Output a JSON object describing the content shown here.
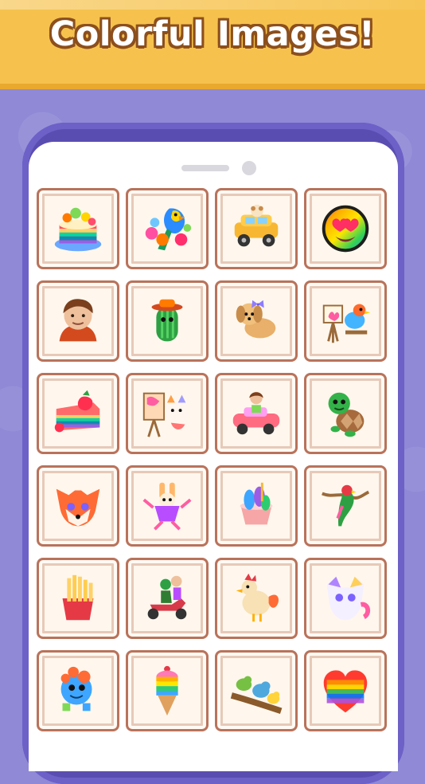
{
  "banner": {
    "title": "Colorful Images!"
  },
  "colors": {
    "background": "#8f89d6",
    "banner": "#f6c24d",
    "banner_outline": "#8c4f1d",
    "phone_frame": "#5a4db1",
    "card_border": "#b9735b"
  },
  "tiles": [
    {
      "name": "rainbow-cake-icon"
    },
    {
      "name": "parrot-flowers-icon"
    },
    {
      "name": "dog-car-icon"
    },
    {
      "name": "heart-eyes-emoji-icon"
    },
    {
      "name": "boy-portrait-icon"
    },
    {
      "name": "cactus-hat-icon"
    },
    {
      "name": "puppy-bow-icon"
    },
    {
      "name": "bird-easel-icon"
    },
    {
      "name": "strawberry-cake-icon"
    },
    {
      "name": "cat-painter-icon"
    },
    {
      "name": "girl-car-icon"
    },
    {
      "name": "turtle-icon"
    },
    {
      "name": "fox-face-icon"
    },
    {
      "name": "rabbit-dancer-icon"
    },
    {
      "name": "ice-cream-cup-icon"
    },
    {
      "name": "parrot-branch-icon"
    },
    {
      "name": "french-fries-icon"
    },
    {
      "name": "scooter-riders-icon"
    },
    {
      "name": "rooster-icon"
    },
    {
      "name": "fluffy-cat-icon"
    },
    {
      "name": "baby-dinosaur-icon"
    },
    {
      "name": "ice-cream-cone-icon"
    },
    {
      "name": "birds-branch-icon"
    },
    {
      "name": "rainbow-heart-icon"
    }
  ]
}
